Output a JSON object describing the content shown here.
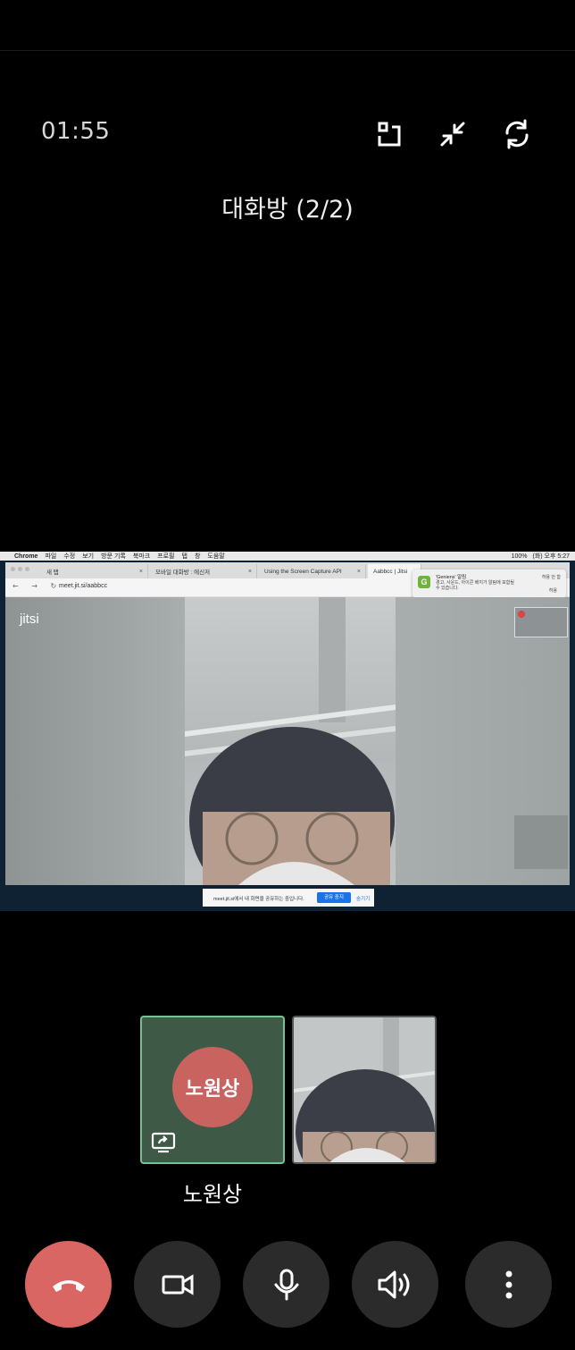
{
  "call": {
    "timer": "01:55",
    "room_title": "대화방 (2/2)"
  },
  "top_icons": [
    "pip-icon",
    "minimize-icon",
    "switch-camera-icon"
  ],
  "shared_screen": {
    "mac_menu": [
      "Chrome",
      "파일",
      "수정",
      "보기",
      "방문 기록",
      "북마크",
      "프로필",
      "탭",
      "창",
      "도움말"
    ],
    "mac_status": [
      "100%",
      "(화) 오후 5:27"
    ],
    "browser_tabs": [
      {
        "label": "새 탭"
      },
      {
        "label": "모바일 대화방 : 에신저"
      },
      {
        "label": "Using the Screen Capture API"
      },
      {
        "label": "Aabbcc | Jitsi"
      }
    ],
    "url": "meet.jit.si/aabbcc",
    "notification": {
      "title": "'Geniens' 알림",
      "body": "경고, 사운드, 아이콘 배지가 알림에 포함될 수 있습니다.",
      "allow_label": "허용 안 함",
      "deny_label": "허용",
      "icon": "G"
    },
    "jitsi_logo": "jitsi",
    "share_bar": {
      "message": "meet.jit.si에서 내 화면을 공유하는 중입니다.",
      "stop_label": "공유 중지",
      "hide_label": "숨기기"
    }
  },
  "participants": [
    {
      "name": "노원상",
      "avatar_text": "노원상",
      "avatar_color": "#c86360",
      "tile_color": "#3e5a46",
      "border_color": "#75c296",
      "sharing_screen": true
    },
    {
      "name": "",
      "video": true
    }
  ],
  "speaker_name": "노원상",
  "controls": [
    {
      "name": "end-call",
      "color": "#d96663"
    },
    {
      "name": "camera"
    },
    {
      "name": "microphone"
    },
    {
      "name": "speaker"
    },
    {
      "name": "more"
    }
  ]
}
